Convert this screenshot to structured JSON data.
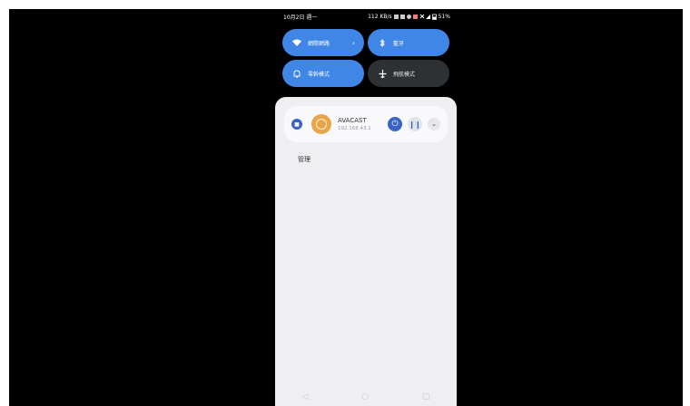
{
  "status_bar": {
    "datetime": "10月2日 週一",
    "net_speed": "112 KB/s",
    "battery": "51%"
  },
  "quick_tiles": [
    {
      "label": "網際網路",
      "state": "on",
      "icon": "wifi-icon",
      "has_chevron": true
    },
    {
      "label": "藍牙",
      "state": "on",
      "icon": "bluetooth-icon",
      "has_chevron": false
    },
    {
      "label": "零幹模式",
      "state": "on",
      "icon": "bell-icon",
      "has_chevron": false
    },
    {
      "label": "飛航模式",
      "state": "off",
      "icon": "airplane-icon",
      "has_chevron": false
    }
  ],
  "media_card": {
    "app_name": "AVACAST",
    "ip": "192.168.43.1",
    "badge_icon": "app-badge-icon",
    "power_icon": "power-icon",
    "pause_icon": "pause-icon",
    "expand_icon": "chevron-down-icon"
  },
  "panel": {
    "manage_label": "管理"
  },
  "navbar": {
    "icons": [
      "back-icon",
      "home-icon",
      "recents-icon"
    ]
  },
  "colors": {
    "tile_on": "#3f86e6",
    "tile_off": "#2e3133",
    "panel_bg": "#efeff2",
    "accent": "#3a63c6",
    "app_icon": "#e8a54a"
  }
}
